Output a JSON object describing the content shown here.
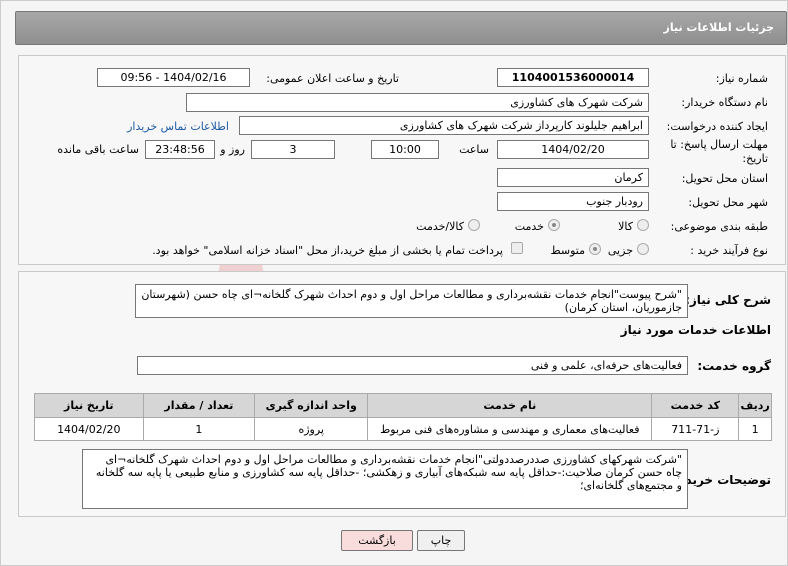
{
  "header": {
    "title": "جزئیات اطلاعات نیاز"
  },
  "form": {
    "need_number_label": "شماره نیاز:",
    "need_number": "1104001536000014",
    "announce_label": "تاریخ و ساعت اعلان عمومی:",
    "announce_value": "1404/02/16 - 09:56",
    "buyer_org_label": "نام دستگاه خریدار:",
    "buyer_org": "شرکت شهرک های کشاورزی",
    "creator_label": "ایجاد کننده درخواست:",
    "creator": "ابراهیم جلیلوند کارپرداز شرکت شهرک های کشاورزی",
    "contact_link": "اطلاعات تماس خریدار",
    "deadline_label": "مهلت ارسال پاسخ: تا تاریخ:",
    "deadline_date": "1404/02/20",
    "time_label": "ساعت",
    "deadline_time": "10:00",
    "days_value": "3",
    "days_label": "روز و",
    "remaining_value": "23:48:56",
    "remaining_label": "ساعت باقی مانده",
    "province_label": "استان محل تحویل:",
    "province": "کرمان",
    "city_label": "شهر محل تحویل:",
    "city": "رودبار جنوب",
    "category_label": "طبقه بندی موضوعی:",
    "category_options": [
      "کالا",
      "خدمت",
      "کالا/خدمت"
    ],
    "process_label": "نوع فرآیند خرید :",
    "process_options": [
      "جزیی",
      "متوسط"
    ],
    "payment_note": "پرداخت تمام یا بخشی از مبلغ خرید،از محل \"اسناد خزانه اسلامی\" خواهد بود."
  },
  "details": {
    "summary_label": "شرح کلی نیاز:",
    "summary_text": "\"شرح پیوست\"انجام خدمات نقشه‌برداری و مطالعات مراحل اول و دوم احداث شهرک گلخانه¬ای چاه حسن (شهرستان جازموریان، استان کرمان)",
    "services_title": "اطلاعات خدمات مورد نیاز",
    "service_group_label": "گروه خدمت:",
    "service_group": "فعالیت‌های حرفه‌ای، علمی و فنی",
    "table": {
      "headers": [
        "ردیف",
        "کد خدمت",
        "نام خدمت",
        "واحد اندازه گیری",
        "تعداد / مقدار",
        "تاریخ نیاز"
      ],
      "rows": [
        [
          "1",
          "ز-71-711",
          "فعالیت‌های معماری و مهندسی و مشاوره‌های فنی مربوط",
          "پروژه",
          "1",
          "1404/02/20"
        ]
      ]
    },
    "buyer_desc_label": "توضیحات خریدار:",
    "buyer_desc": "\"شرکت شهرکهای کشاورزی صددرصددولتی\"انجام خدمات نقشه‌برداری و مطالعات مراحل اول و دوم احداث شهرک گلخانه¬ای چاه حسن کرمان  صلاحیت:-حداقل پایه سه شبکه‌های آبیاری و زهکشی؛ -حداقل پایه سه کشاورزی و منابع طبیعی یا پایه سه گلخانه و مجتمع‌های گلخانه‌ای؛"
  },
  "buttons": {
    "print": "چاپ",
    "back": "بازگشت"
  },
  "watermark_text": "AriaTender.neT"
}
